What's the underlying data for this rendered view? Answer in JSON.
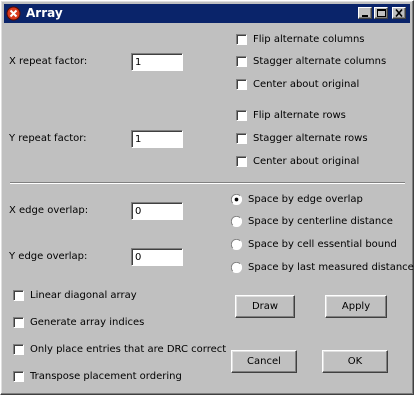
{
  "window": {
    "title": "Array"
  },
  "fields": {
    "x_repeat_label": "X repeat factor:",
    "x_repeat_value": "1",
    "y_repeat_label": "Y repeat factor:",
    "y_repeat_value": "1",
    "x_overlap_label": "X edge overlap:",
    "x_overlap_value": "0",
    "y_overlap_label": "Y edge overlap:",
    "y_overlap_value": "0"
  },
  "column_options": [
    {
      "label": "Flip alternate columns",
      "checked": false
    },
    {
      "label": "Stagger alternate columns",
      "checked": false
    },
    {
      "label": "Center about original",
      "checked": false
    }
  ],
  "row_options": [
    {
      "label": "Flip alternate rows",
      "checked": false
    },
    {
      "label": "Stagger alternate rows",
      "checked": false
    },
    {
      "label": "Center about original",
      "checked": false
    }
  ],
  "spacing_options": [
    {
      "label": "Space by edge overlap",
      "selected": true
    },
    {
      "label": "Space by centerline distance",
      "selected": false
    },
    {
      "label": "Space by cell essential bound",
      "selected": false
    },
    {
      "label": "Space by last measured distance",
      "selected": false
    }
  ],
  "misc_options": [
    {
      "label": "Linear diagonal array",
      "checked": false
    },
    {
      "label": "Generate array indices",
      "checked": false
    },
    {
      "label": "Only place entries that are DRC correct",
      "checked": false
    },
    {
      "label": "Transpose placement ordering",
      "checked": false
    }
  ],
  "buttons": {
    "draw": "Draw",
    "apply": "Apply",
    "cancel": "Cancel",
    "ok": "OK"
  }
}
